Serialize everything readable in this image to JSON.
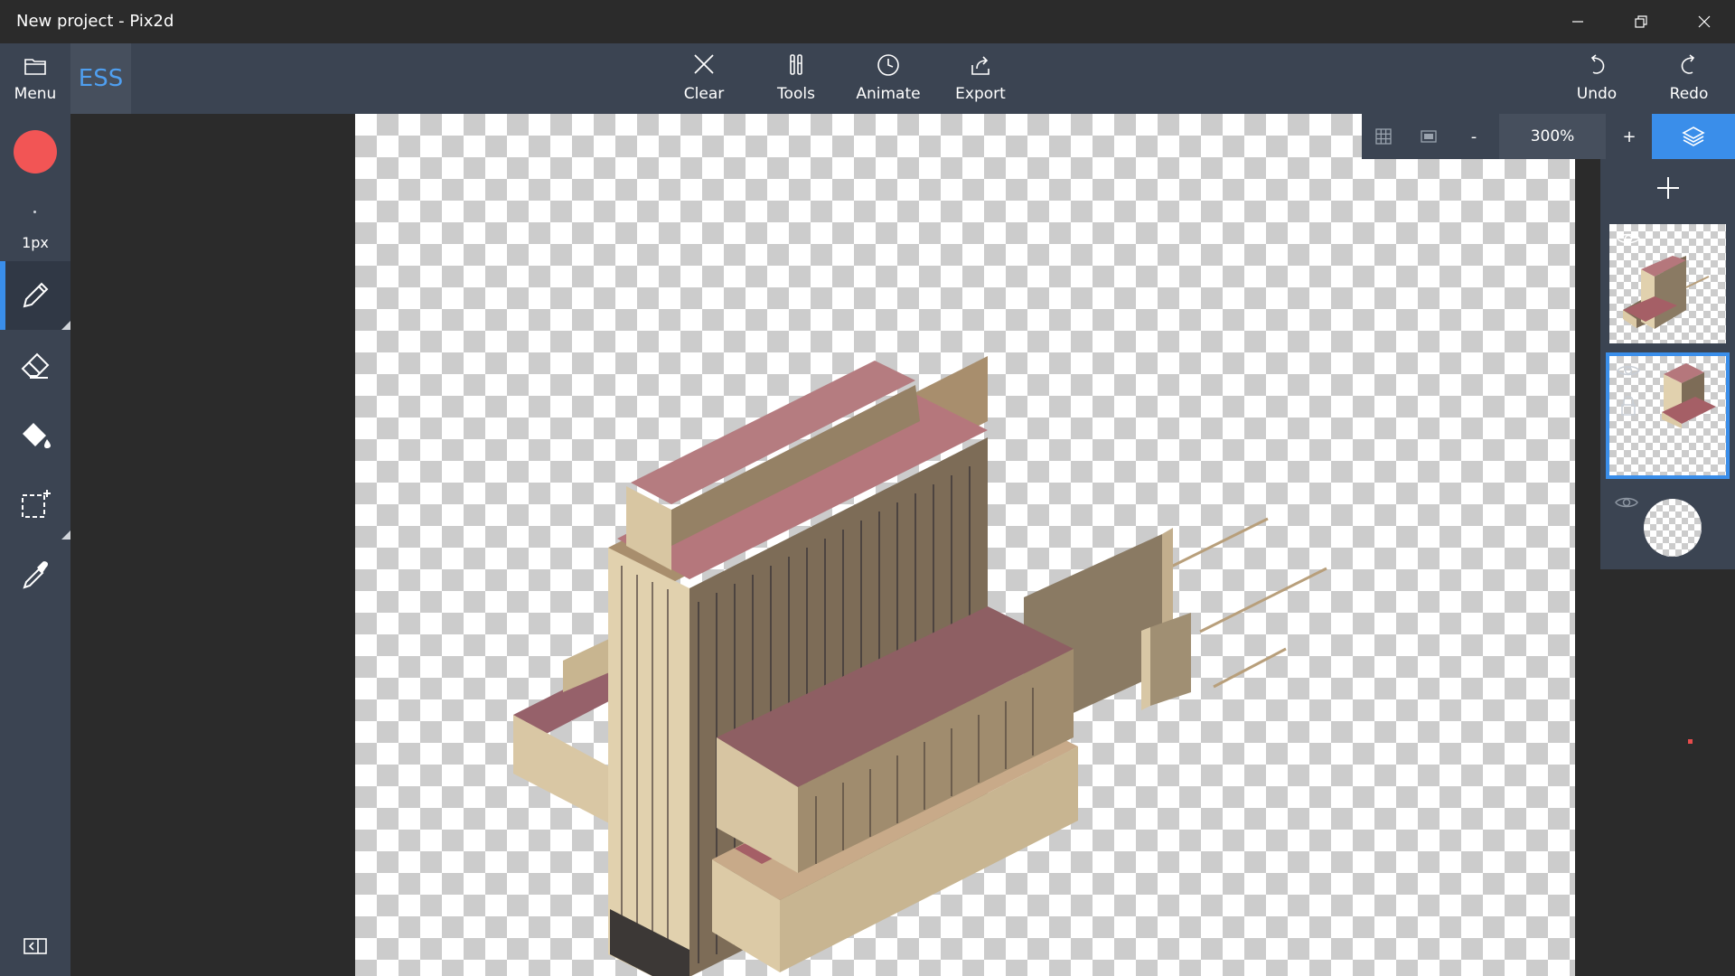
{
  "window": {
    "title": "New project - Pix2d"
  },
  "toolbar": {
    "menu_label": "Menu",
    "brand_label": "ESS",
    "clear_label": "Clear",
    "tools_label": "Tools",
    "animate_label": "Animate",
    "export_label": "Export",
    "undo_label": "Undo",
    "redo_label": "Redo"
  },
  "left_tools": {
    "current_color": "#f25555",
    "brush_size_label": "1px",
    "active_tool": "pencil",
    "items": [
      {
        "name": "pencil",
        "icon": "pencil-icon"
      },
      {
        "name": "eraser",
        "icon": "eraser-icon"
      },
      {
        "name": "fill",
        "icon": "paint-bucket-icon"
      },
      {
        "name": "select",
        "icon": "selection-icon"
      },
      {
        "name": "picker",
        "icon": "eyedropper-icon"
      }
    ]
  },
  "view": {
    "zoom": "300%",
    "zoom_out_label": "-",
    "zoom_in_label": "+"
  },
  "layers": {
    "items": [
      {
        "visible": true,
        "locked": false,
        "selected": false
      },
      {
        "visible": false,
        "locked": true,
        "selected": true
      },
      {
        "visible": false,
        "locked": false,
        "selected": false
      }
    ]
  },
  "colors": {
    "accent": "#3a8eea",
    "panel": "#3b4452",
    "background": "#2b2b2b"
  }
}
